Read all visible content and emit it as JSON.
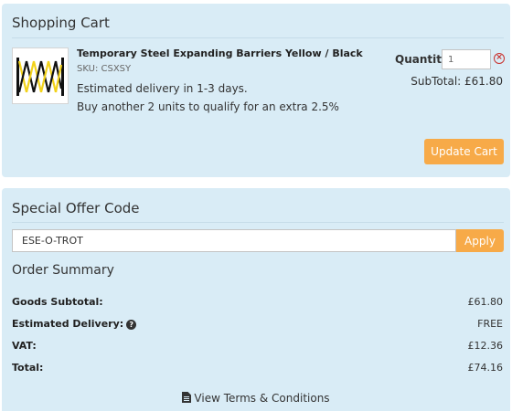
{
  "cart": {
    "title": "Shopping Cart",
    "item": {
      "name": "Temporary Steel Expanding Barriers Yellow / Black",
      "sku": "SKU: CSXSY",
      "delivery": "Estimated delivery in 1-3 days.",
      "offer": "Buy another 2 units to qualify for an extra 2.5%",
      "quantity_label": "Quantity",
      "quantity_value": "1",
      "subtotal": "SubTotal: £61.80",
      "image_icon": "barrier-product-image",
      "remove_icon": "remove-circle-icon"
    },
    "update_label": "Update Cart"
  },
  "offer": {
    "title": "Special Offer Code",
    "code_value": "ESE-O-TROT",
    "apply_label": "Apply"
  },
  "summary": {
    "title": "Order Summary",
    "rows": [
      {
        "label": "Goods Subtotal:",
        "value": "£61.80"
      },
      {
        "label": "Estimated Delivery:",
        "value": "FREE"
      },
      {
        "label": "VAT:",
        "value": "£12.36"
      },
      {
        "label": "Total:",
        "value": "£74.16"
      }
    ],
    "terms_label": "View Terms & Conditions"
  },
  "colors": {
    "panel": "#d9ecf6",
    "accent": "#f7aa48",
    "remove": "#c9302c"
  }
}
